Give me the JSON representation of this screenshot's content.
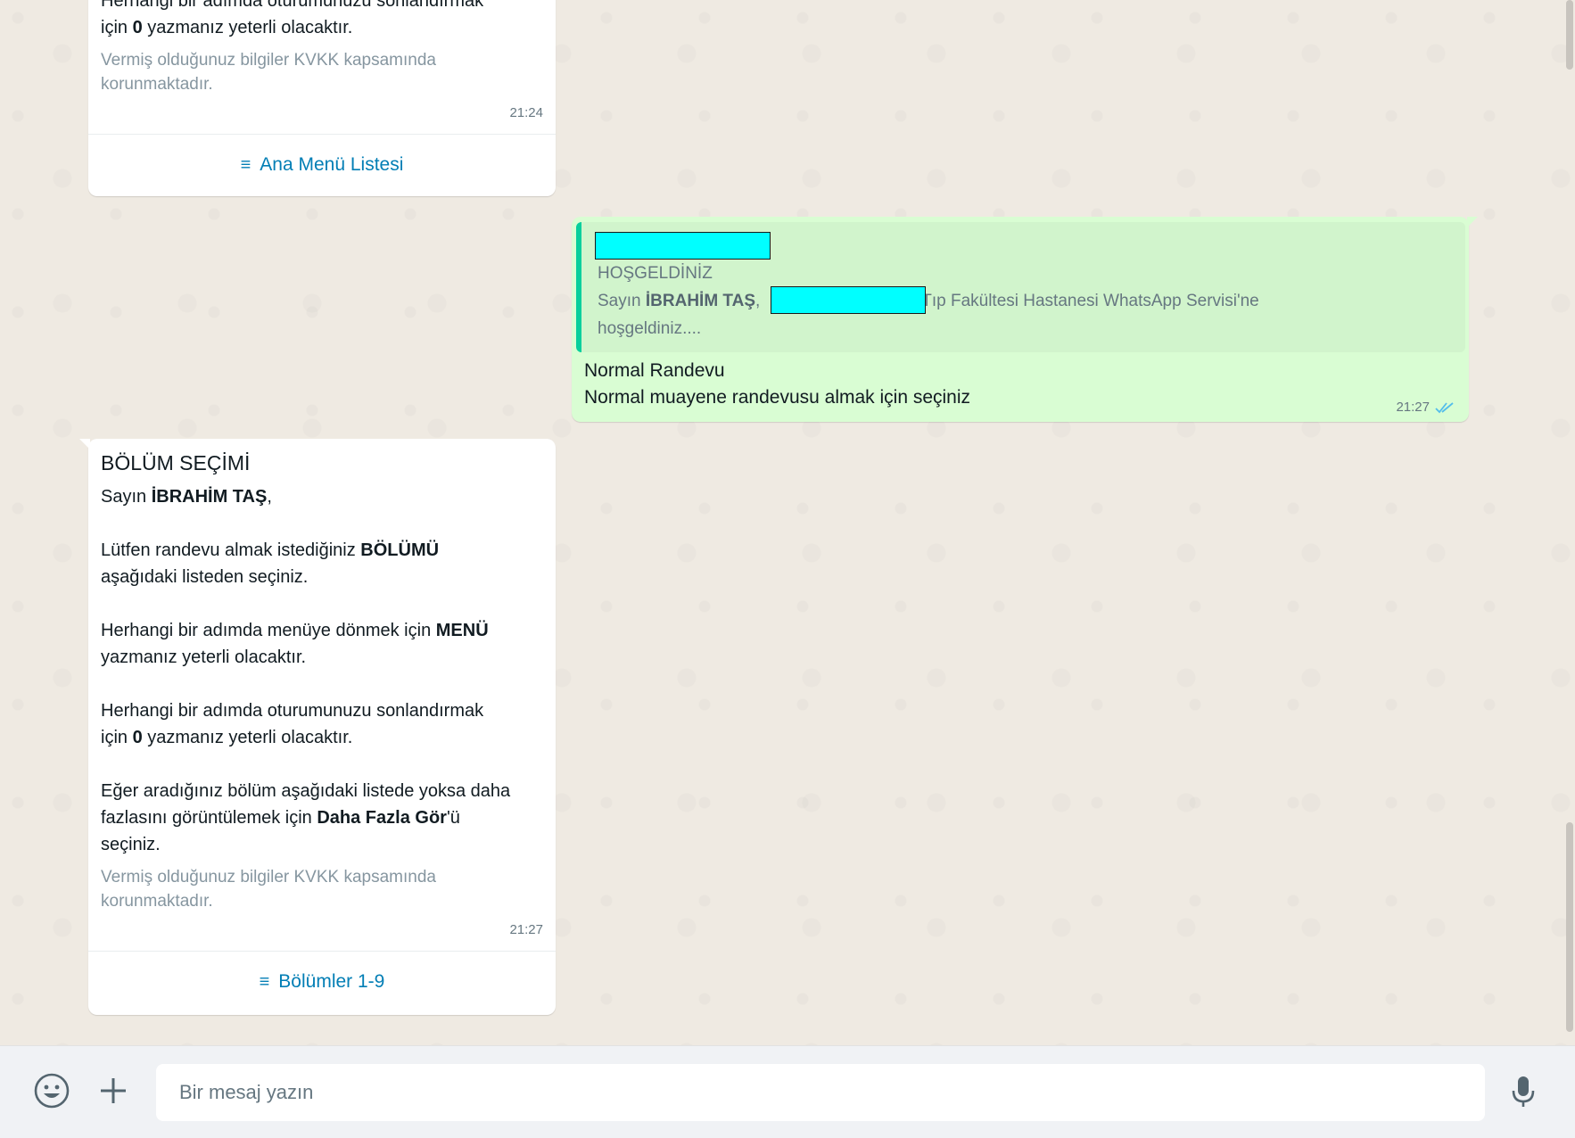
{
  "messages": {
    "top_incoming": {
      "partial_line": "Herhangi bir adımda oturumunuzu sonlandırmak",
      "line2_pre": "için ",
      "line2_bold": "0",
      "line2_post": " yazmanız yeterli olacaktır.",
      "kvkk": "Vermiş olduğunuz bilgiler KVKK kapsamında korunmaktadır.",
      "time": "21:24",
      "button_label": "Ana Menü Listesi"
    },
    "outgoing": {
      "quote_title": "HOŞGELDİNİZ",
      "quote_line_pre": "Sayın ",
      "quote_line_bold": "İBRAHİM TAŞ",
      "quote_line_comma": ",",
      "quote_line_post": " Tıp Fakültesi Hastanesi WhatsApp Servisi'ne",
      "quote_line3": "hoşgeldiniz....",
      "line1": "Normal Randevu",
      "line2": "Normal muayene randevusu almak için seçiniz",
      "time": "21:27"
    },
    "section_select": {
      "title": "BÖLÜM SEÇİMİ",
      "greeting_pre": "Sayın ",
      "greeting_bold": "İBRAHİM TAŞ",
      "greeting_post": ",",
      "p1_pre": "Lütfen randevu almak istediğiniz ",
      "p1_bold": "BÖLÜMÜ",
      "p1_post": "aşağıdaki listeden seçiniz.",
      "p2_pre": "Herhangi bir adımda menüye dönmek için ",
      "p2_bold": "MENÜ",
      "p2_post": "yazmanız yeterli olacaktır.",
      "p3_line1": "Herhangi bir adımda oturumunuzu sonlandırmak",
      "p3_pre": "için ",
      "p3_bold": "0",
      "p3_post": " yazmanız yeterli olacaktır.",
      "p4_line1": "Eğer aradığınız bölüm aşağıdaki listede yoksa daha",
      "p4_pre": "fazlasını görüntülemek için ",
      "p4_bold": "Daha Fazla Gör",
      "p4_post": "'ü",
      "p4_line3": "seçiniz.",
      "kvkk": "Vermiş olduğunuz bilgiler KVKK kapsamında korunmaktadır.",
      "time": "21:27",
      "button_label": "Bölümler 1-9"
    }
  },
  "composer": {
    "placeholder": "Bir mesaj yazın"
  },
  "icons": {
    "emoji": "emoji-icon",
    "attach": "plus-icon",
    "mic": "mic-icon",
    "list": "list-icon",
    "read": "double-check-icon"
  },
  "colors": {
    "chat_bg": "#efeae2",
    "incoming_bg": "#ffffff",
    "outgoing_bg": "#d9fdd3",
    "link_blue": "#027eb5",
    "read_tick": "#53bdeb",
    "redaction": "#00ffff"
  }
}
